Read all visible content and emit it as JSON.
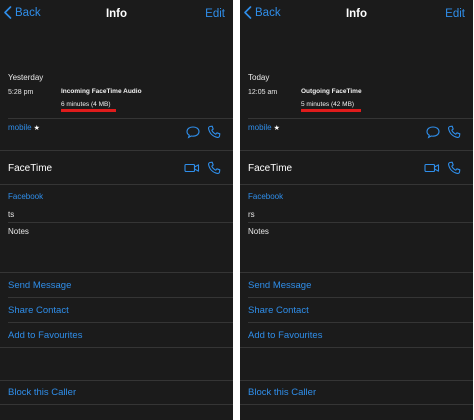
{
  "colors": {
    "accent": "#2f8eea",
    "background": "#1b1b1b",
    "highlight": "#e01c1c"
  },
  "left": {
    "nav": {
      "back": "Back",
      "title": "Info",
      "edit": "Edit"
    },
    "call": {
      "day": "Yesterday",
      "time": "5:28 pm",
      "type": "Incoming FaceTime Audio",
      "duration": "6 minutes (4 MB)"
    },
    "phone_label": "mobile",
    "facetime_label": "FaceTime",
    "facebook_label": "Facebook",
    "facebook_value": "ts",
    "notes_label": "Notes",
    "actions": {
      "send": "Send Message",
      "share": "Share Contact",
      "favourites": "Add to Favourites",
      "block": "Block this Caller"
    }
  },
  "right": {
    "nav": {
      "back": "Back",
      "title": "Info",
      "edit": "Edit"
    },
    "call": {
      "day": "Today",
      "time": "12:05 am",
      "type": "Outgoing FaceTime",
      "duration": "5 minutes (42 MB)"
    },
    "phone_label": "mobile",
    "facetime_label": "FaceTime",
    "facebook_label": "Facebook",
    "facebook_value": "rs",
    "notes_label": "Notes",
    "actions": {
      "send": "Send Message",
      "share": "Share Contact",
      "favourites": "Add to Favourites",
      "block": "Block this Caller"
    }
  },
  "icons": [
    "chevron-left-icon",
    "message-icon",
    "phone-icon",
    "video-icon"
  ]
}
